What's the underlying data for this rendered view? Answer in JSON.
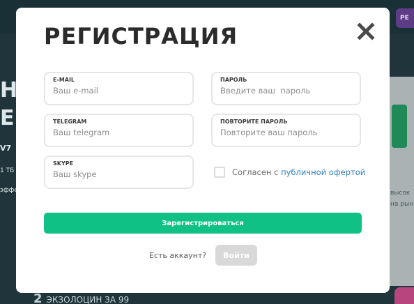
{
  "background": {
    "top_right_button_label": "РЕ",
    "big_text_1": "Н",
    "big_text_2": "Е",
    "small_text_1": "V7",
    "small_text_2": "1 ТБ",
    "small_text_3": "эффе",
    "card_text_1": "высок",
    "card_text_2": "на рын",
    "bottom_number": "2",
    "bottom_text": "ЭКЗОЛОЦИН ЗА 99"
  },
  "modal": {
    "title": "РЕГИСТРАЦИЯ",
    "close_icon": "close-icon",
    "fields": {
      "email": {
        "label": "E-MAIL",
        "placeholder": "Ваш e-mail",
        "value": ""
      },
      "password": {
        "label": "ПАРОЛЬ",
        "placeholder": "Введите ваш  пароль",
        "value": ""
      },
      "telegram": {
        "label": "TELEGRAM",
        "placeholder": "Ваш telegram",
        "value": ""
      },
      "password_repeat": {
        "label": "ПОВТОРИТЕ ПАРОЛЬ",
        "placeholder": "Повторите ваш пароль",
        "value": ""
      },
      "skype": {
        "label": "SKYPE",
        "placeholder": "Ваш skype",
        "value": ""
      }
    },
    "agree": {
      "prefix": "Согласен с",
      "link_text": "публичной офертой",
      "checked": false
    },
    "submit_label": "Зарегистрироваться",
    "account_question": "Есть аккаунт?",
    "login_label": "Войти"
  },
  "colors": {
    "accent": "#10c185",
    "link": "#2f7fbf",
    "overlay": "#1d3137",
    "login_disabled": "#d9d9d9"
  }
}
